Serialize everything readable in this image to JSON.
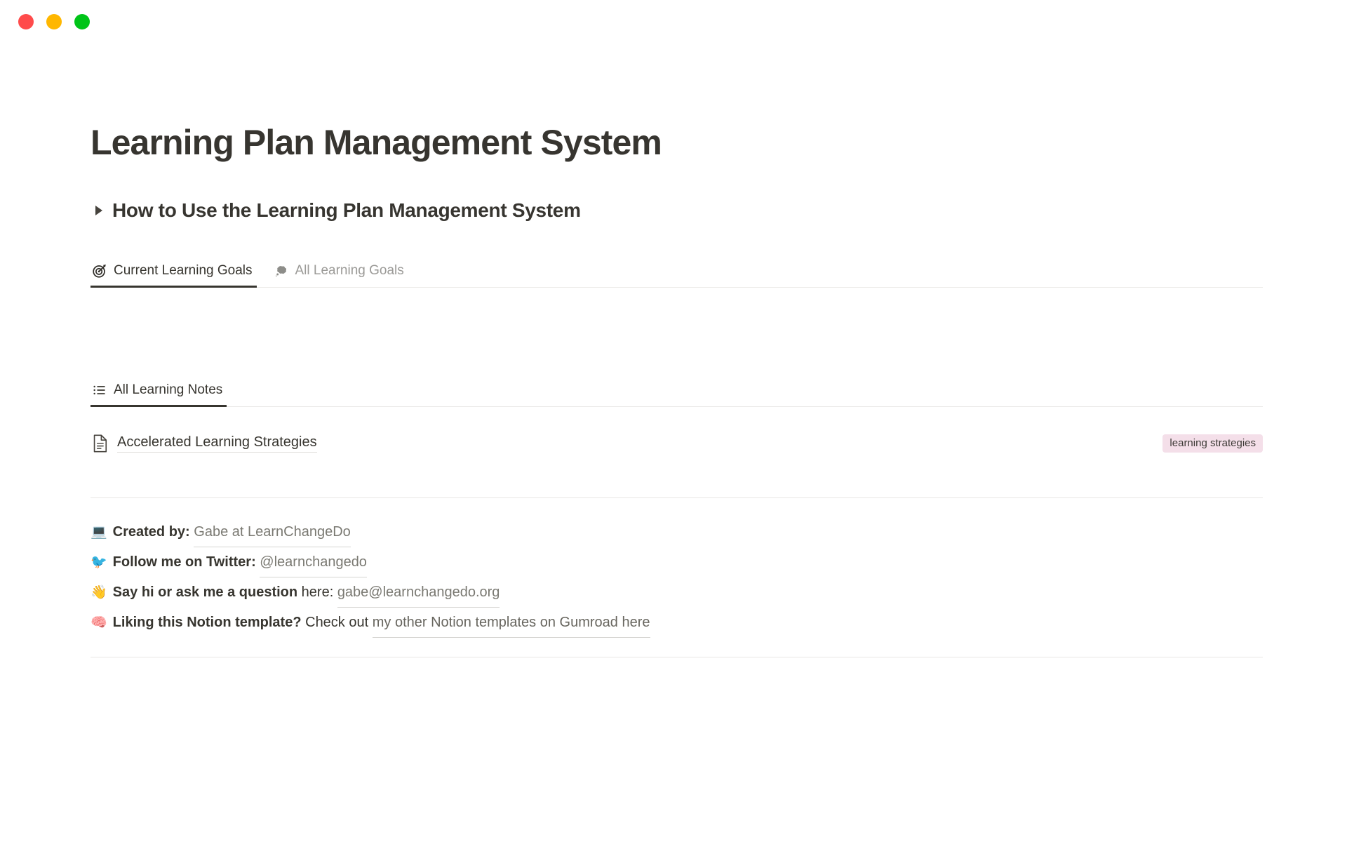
{
  "window": {
    "traffic_lights": [
      {
        "name": "close",
        "color": "#ff4b4b"
      },
      {
        "name": "minimize",
        "color": "#ffb700"
      },
      {
        "name": "zoom",
        "color": "#00c418"
      }
    ]
  },
  "page": {
    "title": "Learning Plan Management System",
    "toggle_heading": "How to Use the Learning Plan Management System"
  },
  "goals_tabs": {
    "items": [
      {
        "label": "Current Learning Goals",
        "icon": "target-icon",
        "active": true
      },
      {
        "label": "All Learning Goals",
        "icon": "thought-bubble-icon",
        "active": false
      }
    ]
  },
  "notes_tabs": {
    "items": [
      {
        "label": "All Learning Notes",
        "icon": "list-icon",
        "active": true
      }
    ]
  },
  "notes": {
    "rows": [
      {
        "icon": "document-icon",
        "title": "Accelerated Learning Strategies",
        "tag": "learning strategies",
        "tag_color": "#f4dfe9"
      }
    ]
  },
  "footer": {
    "lines": [
      {
        "emoji": "💻",
        "emoji_name": "laptop-emoji",
        "bold": "Created by:",
        "plain": " ",
        "link": "Gabe at LearnChangeDo"
      },
      {
        "emoji": "🐦",
        "emoji_name": "bird-emoji",
        "bold": "Follow me on Twitter:",
        "plain": " ",
        "link": "@learnchangedo"
      },
      {
        "emoji": "👋",
        "emoji_name": "waving-hand-emoji",
        "bold": "Say hi or ask me a question",
        "plain": " here: ",
        "link": "gabe@learnchangedo.org"
      },
      {
        "emoji": "🧠",
        "emoji_name": "brain-emoji",
        "bold": "Liking this Notion template?",
        "plain": " Check out ",
        "link": "my other Notion templates on Gumroad here"
      }
    ]
  }
}
